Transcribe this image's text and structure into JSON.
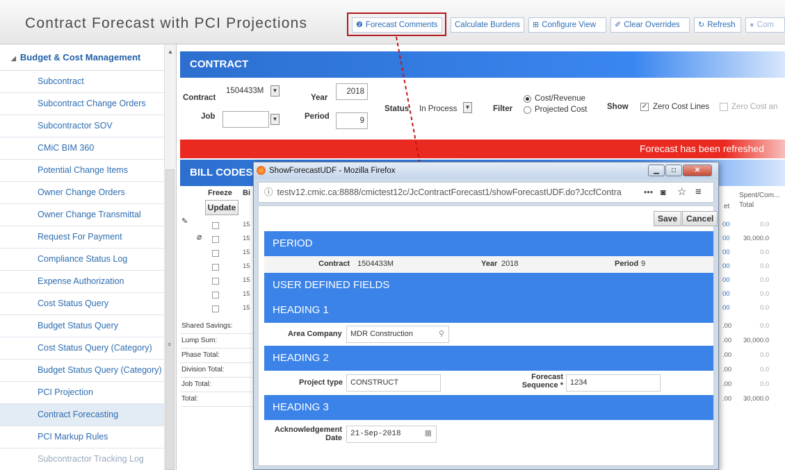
{
  "header": {
    "title": "Contract Forecast with PCI Projections",
    "buttons": [
      {
        "icon": "❷",
        "label": "Forecast Comments"
      },
      {
        "label": "Calculate Burdens"
      },
      {
        "icon": "⊞",
        "label": "Configure View"
      },
      {
        "icon": "✐",
        "label": "Clear Overrides"
      },
      {
        "icon": "↻",
        "label": "Refresh"
      },
      {
        "icon": "●",
        "label": "Com"
      }
    ]
  },
  "sidebar": {
    "section_label": "Budget & Cost Management",
    "items": [
      {
        "label": "Subcontract"
      },
      {
        "label": "Subcontract Change Orders"
      },
      {
        "label": "Subcontractor SOV"
      },
      {
        "label": "CMiC BIM 360"
      },
      {
        "label": "Potential Change Items"
      },
      {
        "label": "Owner Change Orders"
      },
      {
        "label": "Owner Change Transmittal"
      },
      {
        "label": "Request For Payment"
      },
      {
        "label": "Compliance Status Log"
      },
      {
        "label": "Expense Authorization"
      },
      {
        "label": "Cost Status Query"
      },
      {
        "label": "Budget Status Query"
      },
      {
        "label": "Cost Status Query (Category)"
      },
      {
        "label": "Budget Status Query (Category)"
      },
      {
        "label": "PCI Projection"
      },
      {
        "label": "Contract Forecasting"
      },
      {
        "label": "PCI Markup Rules"
      },
      {
        "label": "Subcontractor Tracking Log"
      }
    ]
  },
  "contract": {
    "title": "CONTRACT",
    "contract_label": "Contract",
    "contract_value": "1504433M",
    "job_label": "Job",
    "job_value": "",
    "year_label": "Year",
    "year_value": "2018",
    "period_label": "Period",
    "period_value": "9",
    "status_label": "Status",
    "status_value": "In Process",
    "filter_label": "Filter",
    "filter_opt1": "Cost/Revenue",
    "filter_opt2": "Projected Cost",
    "show_label": "Show",
    "show_opt1": "Zero Cost Lines",
    "show_opt2": "Zero Cost an"
  },
  "banner": {
    "message": "Forecast has been refreshed"
  },
  "billcodes": {
    "title": "BILL CODES",
    "freeze_label": "Freeze",
    "update_label": "Update",
    "bi_label": "Bi",
    "row_code": "15",
    "totals": [
      {
        "label": "Shared Savings:",
        "val_a": ".00",
        "val_b": "0.0"
      },
      {
        "label": "Lump Sum:",
        "val_a": ".00",
        "val_b": "30,000.0"
      },
      {
        "label": "Phase Total:",
        "val_a": ".00",
        "val_b": "0.0"
      },
      {
        "label": "Division Total:",
        "val_a": ".00",
        "val_b": "0.0"
      },
      {
        "label": "Job Total:",
        "val_a": ".00",
        "val_b": "0.0"
      },
      {
        "label": "Total:",
        "val_a": ".00",
        "val_b": "30,000.0"
      }
    ],
    "col_et": "et",
    "col_spent": "Spent/Com...",
    "col_total": "Total",
    "rows_a": [
      "00",
      "00",
      "00",
      "00",
      "00",
      "00",
      "00"
    ],
    "rows_b": [
      "0.0",
      "30,000.0",
      "0.0",
      "0.0",
      "0.0",
      "0.0",
      "0.0"
    ]
  },
  "popup": {
    "window_title": "ShowForecastUDF - Mozilla Firefox",
    "url": "testv12.cmic.ca:8888/cmictest12c/JcContractForecast1/showForecastUDF.do?JccfContra",
    "save_label": "Save",
    "cancel_label": "Cancel",
    "period_heading": "PERIOD",
    "contract_label": "Contract",
    "contract_value": "1504433M",
    "year_label": "Year",
    "year_value": "2018",
    "period_label": "Period",
    "period_value": "9",
    "udf_heading": "USER DEFINED FIELDS",
    "heading1": "HEADING 1",
    "area_company_label": "Area Company",
    "area_company_value": "MDR Construction",
    "heading2": "HEADING 2",
    "project_type_label": "Project type",
    "project_type_value": "CONSTRUCT",
    "forecast_seq_label_1": "Forecast",
    "forecast_seq_label_2": "Sequence *",
    "forecast_seq_value": "1234",
    "heading3": "HEADING 3",
    "ack_label_1": "Acknowledgement",
    "ack_label_2": "Date",
    "ack_value": "21-Sep-2018"
  },
  "colors": {
    "blue_bar": "#3a86f0",
    "red_bar": "#ea2a20",
    "highlight": "#b0171c",
    "link": "#2f6eb5"
  }
}
